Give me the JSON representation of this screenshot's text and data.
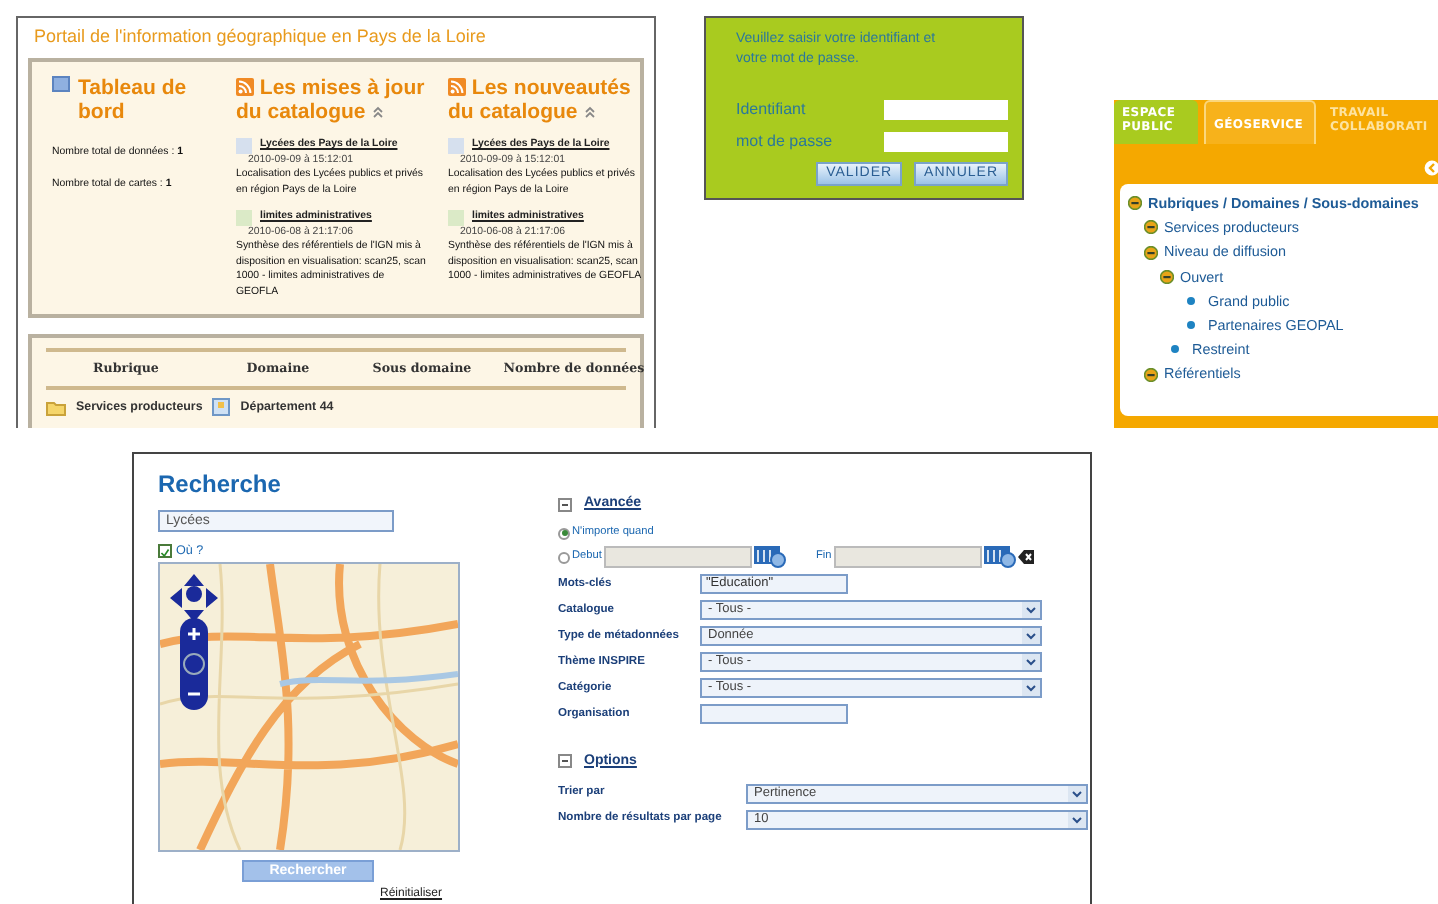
{
  "portal": {
    "title": "Portail de l'information géographique en Pays de la Loire",
    "dashboard": {
      "title": "Tableau de bord",
      "stats": [
        {
          "label": "Nombre total de données :",
          "value": "1"
        },
        {
          "label": "Nombre total de cartes :",
          "value": "1"
        }
      ]
    },
    "feeds": [
      {
        "title": "Les mises à jour du catalogue",
        "items": [
          {
            "title": "Lycées des Pays de la Loire",
            "date": "2010-09-09 à 15:12:01",
            "description": "Localisation des Lycées publics et privés en région Pays de la Loire",
            "kind": "map"
          },
          {
            "title": "limites administratives",
            "date": "2010-06-08 à 21:17:06",
            "description": "Synthèse des référentiels de l'IGN mis à disposition en visualisation: scan25, scan 1000 - limites administratives de GEOFLA",
            "kind": "data"
          }
        ]
      },
      {
        "title": "Les nouveautés du catalogue",
        "items": [
          {
            "title": "Lycées des Pays de la Loire",
            "date": "2010-09-09 à 15:12:01",
            "description": "Localisation des Lycées publics et privés en région Pays de la Loire",
            "kind": "map"
          },
          {
            "title": "limites administratives",
            "date": "2010-06-08 à 21:17:06",
            "description": "Synthèse des référentiels de l'IGN mis à disposition en visualisation: scan25, scan 1000 - limites administratives de GEOFLA",
            "kind": "data"
          }
        ]
      }
    ],
    "table": {
      "columns": [
        "Rubrique",
        "Domaine",
        "Sous domaine",
        "Nombre de données"
      ],
      "rows": [
        [
          "Services producteurs",
          "Département 44"
        ]
      ]
    }
  },
  "login": {
    "message": "Veuillez saisir votre identifiant et votre mot de passe.",
    "fields": [
      "Identifiant",
      "mot de passe"
    ],
    "buttons": [
      "VALIDER",
      "ANNULER"
    ]
  },
  "geoservice": {
    "tabs": [
      {
        "label": "ESPACE PUBLIC",
        "selected": false
      },
      {
        "label": "GÉOSERVICE",
        "selected": true
      },
      {
        "label": "TRAVAIL COLLABORATI",
        "selected": false
      }
    ],
    "tree": {
      "label": "Rubriques / Domaines / Sous-domaines",
      "kind": "node",
      "children": [
        {
          "label": "Services producteurs",
          "kind": "node"
        },
        {
          "label": "Niveau de diffusion",
          "kind": "node",
          "children": [
            {
              "label": "Ouvert",
              "kind": "node",
              "children": [
                {
                  "label": "Grand public",
                  "kind": "leaf"
                },
                {
                  "label": "Partenaires GEOPAL",
                  "kind": "leaf"
                }
              ]
            },
            {
              "label": "Restreint",
              "kind": "leaf"
            }
          ]
        },
        {
          "label": "Référentiels",
          "kind": "node"
        }
      ]
    }
  },
  "search": {
    "title": "Recherche",
    "query": "Lycées",
    "where": {
      "label": "Où ?",
      "checked": true
    },
    "submit": "Rechercher",
    "reset": "Réinitialiser",
    "advanced": {
      "title": "Avancée",
      "expanded": true,
      "dates": [
        {
          "label": "N'importe quand",
          "selected": true
        },
        {
          "label": "Debut",
          "selected": false
        }
      ],
      "end_label": "Fin",
      "fields": [
        {
          "label": "Mots-clés",
          "kind": "text",
          "value": "\"Education\""
        },
        {
          "label": "Catalogue",
          "kind": "select",
          "value": "- Tous -"
        },
        {
          "label": "Type de métadonnées",
          "kind": "select",
          "value": "Donnée"
        },
        {
          "label": "Thème INSPIRE",
          "kind": "select",
          "value": "- Tous -"
        },
        {
          "label": "Catégorie",
          "kind": "select",
          "value": "- Tous -"
        },
        {
          "label": "Organisation",
          "kind": "text"
        }
      ]
    },
    "options": {
      "title": "Options",
      "expanded": true,
      "fields": [
        {
          "label": "Trier par",
          "kind": "select",
          "value": "Pertinence"
        },
        {
          "label": "Nombre de résultats par page",
          "kind": "select",
          "value": "10"
        }
      ]
    }
  }
}
